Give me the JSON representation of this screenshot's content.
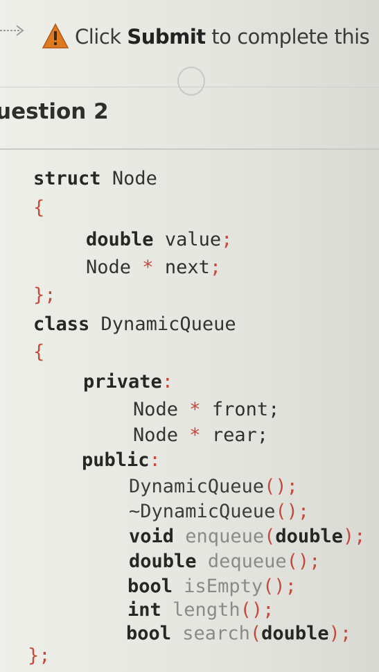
{
  "notice": {
    "prefix": "Click ",
    "emphasis": "Submit",
    "suffix": " to complete this"
  },
  "question": {
    "title": "uestion 2"
  },
  "code": {
    "struct_kw": "struct",
    "struct_name": "Node",
    "open_brace_1": "{",
    "field1_type": "double",
    "field1_name": "value",
    "field2_type": "Node",
    "field2_ptr": "*",
    "field2_name": "next",
    "close_struct": "};",
    "class_kw": "class",
    "class_name": "DynamicQueue",
    "open_brace_2": "{",
    "private_kw": "private",
    "colon": ":",
    "member1_type": "Node",
    "member1_ptr": "*",
    "member1_name": "front;",
    "member2_type": "Node",
    "member2_ptr": "*",
    "member2_name": "rear;",
    "public_kw": "public",
    "ctor_name": "DynamicQueue",
    "ctor_parens": "();",
    "dtor_name": "~DynamicQueue",
    "dtor_parens": "();",
    "m1_ret": "void",
    "m1_name": "enqueue",
    "m1_open": "(",
    "m1_arg": "double",
    "m1_close": ");",
    "m2_ret": "double",
    "m2_name": "dequeue",
    "m2_parens": "();",
    "m3_ret": "bool",
    "m3_name": "isEmpty",
    "m3_parens": "();",
    "m4_ret": "int",
    "m4_name": "length",
    "m4_parens": "();",
    "m5_ret": "bool",
    "m5_name": "search",
    "m5_open": "(",
    "m5_arg": "double",
    "m5_close": ");",
    "close_class": "};"
  },
  "colors": {
    "punctuation": "#c44a3c",
    "warning": "#e07a1f"
  },
  "icons": [
    "arrow-icon",
    "warning-icon",
    "cursor-icon"
  ]
}
